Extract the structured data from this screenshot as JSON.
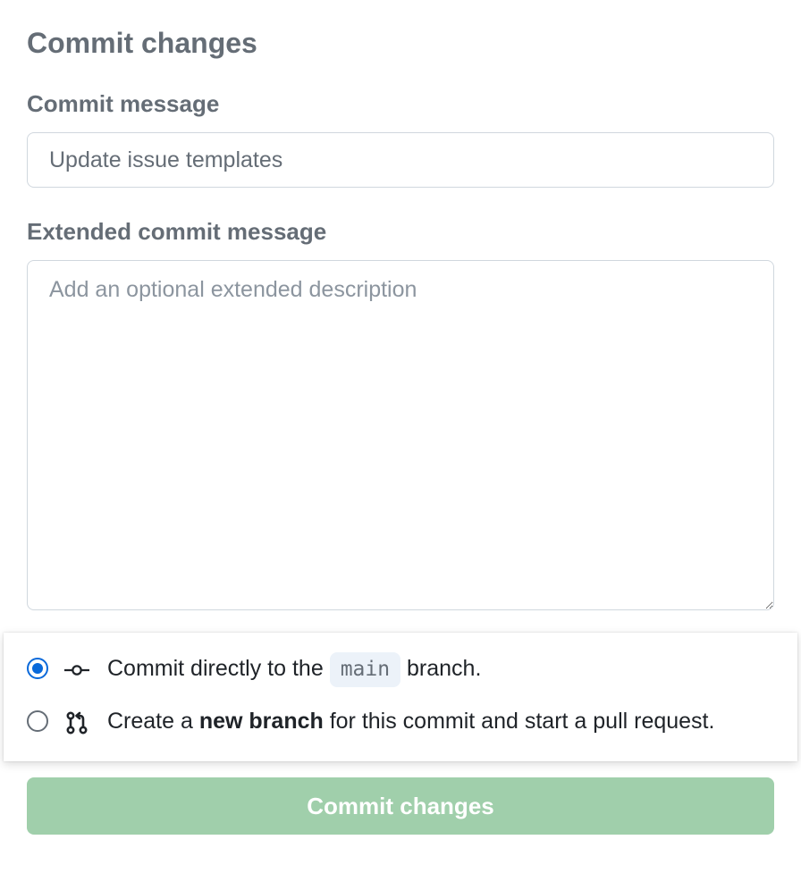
{
  "title": "Commit changes",
  "commit_message": {
    "label": "Commit message",
    "value": "Update issue templates"
  },
  "extended_message": {
    "label": "Extended commit message",
    "placeholder": "Add an optional extended description",
    "value": ""
  },
  "branch_options": {
    "direct": {
      "prefix": "Commit directly to the ",
      "branch": "main",
      "suffix": " branch.",
      "selected": true
    },
    "new_branch": {
      "prefix": "Create a ",
      "bold": "new branch",
      "suffix": " for this commit and start a pull request.",
      "selected": false
    }
  },
  "submit_label": "Commit changes"
}
